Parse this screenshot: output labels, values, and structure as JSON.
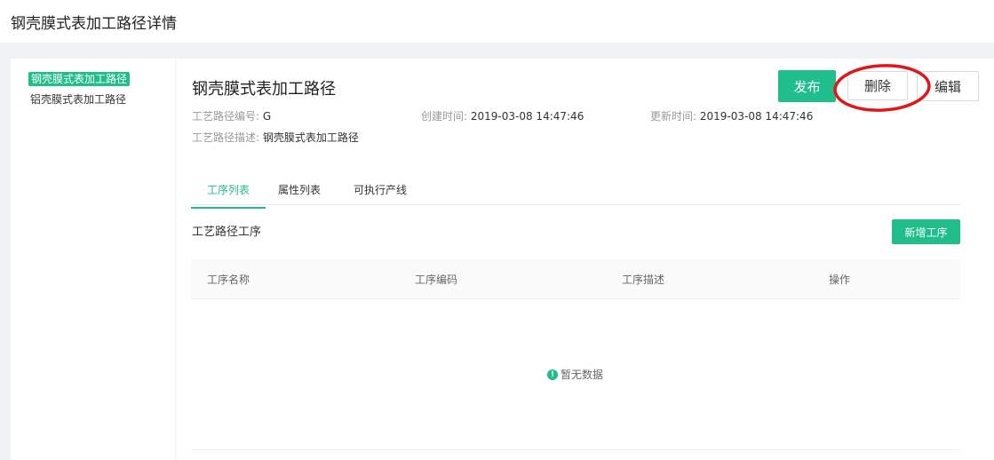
{
  "page": {
    "title": "钢壳膜式表加工路径详情"
  },
  "sidebar": {
    "items": [
      {
        "label": "钢壳膜式表加工路径",
        "active": true
      },
      {
        "label": "铝壳膜式表加工路径",
        "active": false
      }
    ]
  },
  "detail": {
    "title": "钢壳膜式表加工路径",
    "code_label": "工艺路径编号:",
    "code_value": "G",
    "created_label": "创建时间:",
    "created_value": "2019-03-08 14:47:46",
    "updated_label": "更新时间:",
    "updated_value": "2019-03-08 14:47:46",
    "desc_label": "工艺路径描述:",
    "desc_value": "钢壳膜式表加工路径"
  },
  "actions": {
    "publish": "发布",
    "delete": "删除",
    "edit": "编辑"
  },
  "tabs": [
    {
      "label": "工序列表",
      "active": true
    },
    {
      "label": "属性列表",
      "active": false
    },
    {
      "label": "可执行产线",
      "active": false
    }
  ],
  "section": {
    "title": "工艺路径工序",
    "add_button": "新增工序"
  },
  "table": {
    "columns": [
      "工序名称",
      "工序编码",
      "工序描述",
      "操作"
    ],
    "rows": [],
    "empty_text": "暂无数据"
  },
  "colors": {
    "accent": "#1fbe8a",
    "annotation": "#e0161d"
  },
  "icons": {
    "empty_state": "info-circle-icon"
  }
}
